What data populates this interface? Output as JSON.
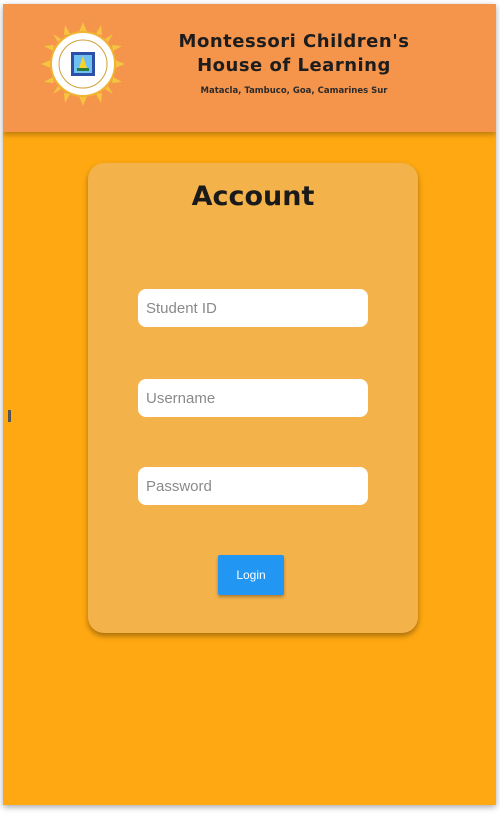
{
  "header": {
    "school_name_line1": "Montessori Children's",
    "school_name_line2": "House of Learning",
    "address": "Matacla, Tambuco, Goa, Camarines Sur",
    "logo_icon": "school-seal-icon"
  },
  "account_card": {
    "title": "Account",
    "student_id_placeholder": "Student ID",
    "username_placeholder": "Username",
    "password_placeholder": "Password",
    "login_label": "Login"
  },
  "colors": {
    "header_bg": "#F5944B",
    "page_bg": "#FFA811",
    "card_bg": "#F4B24A",
    "button_bg": "#2196F3"
  }
}
